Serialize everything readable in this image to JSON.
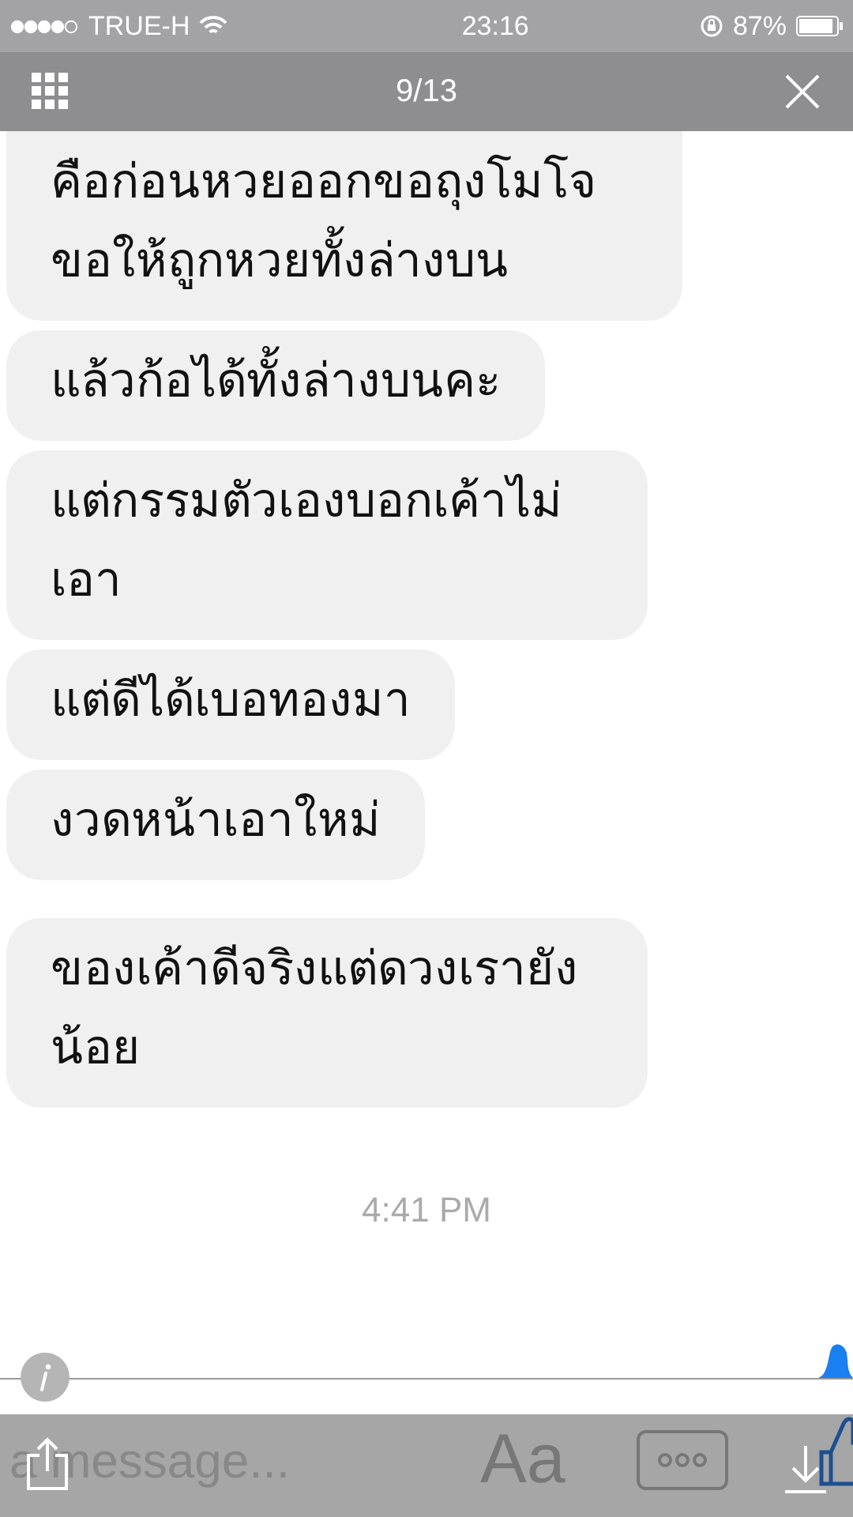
{
  "status_bar": {
    "carrier": "TRUE-H",
    "time": "23:16",
    "battery": "87%"
  },
  "viewer": {
    "counter": "9/13"
  },
  "messages": [
    {
      "text": "คือก่อนหวยออกขอถุงโมโจ ขอให้ถูกหวยทั้งล่างบน",
      "group_start": false
    },
    {
      "text": "แล้วก้อได้ทั้งล่างบนคะ",
      "group_start": false
    },
    {
      "text": "แต่กรรมตัวเองบอกเค้าไม่เอา",
      "group_start": false
    },
    {
      "text": "แต่ดีได้เบอทองมา",
      "group_start": false
    },
    {
      "text": "งวดหน้าเอาใหม่",
      "group_start": false
    },
    {
      "text": "ของเค้าดีจริงแต่ดวงเรายังน้อย",
      "group_start": true
    }
  ],
  "timestamp": "4:41 PM",
  "composer": {
    "placeholder": "a message...",
    "font_button": "Aa"
  }
}
